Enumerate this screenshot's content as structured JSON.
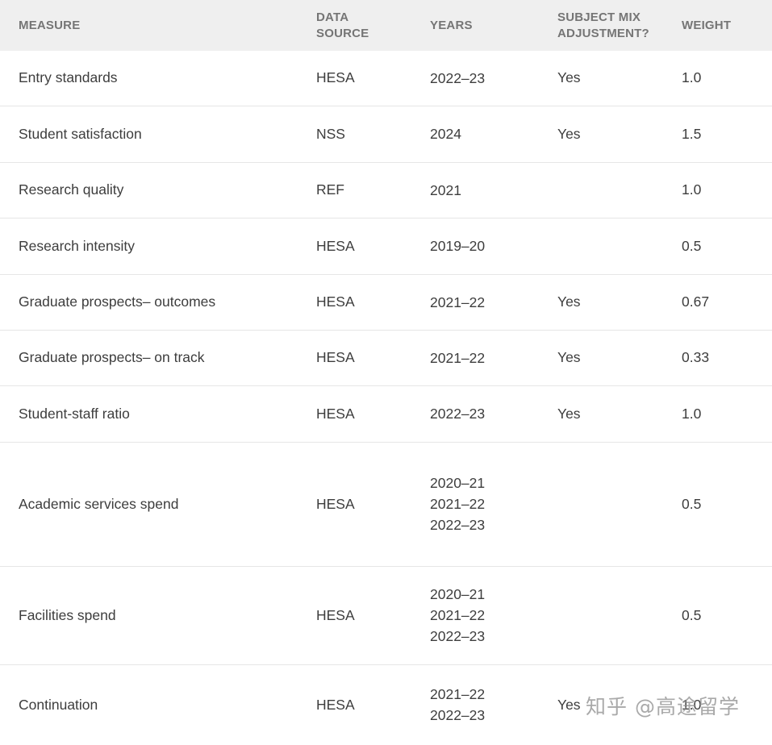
{
  "table": {
    "headers": {
      "measure": "MEASURE",
      "source_line1": "DATA",
      "source_line2": "SOURCE",
      "years": "YEARS",
      "adjust_line1": "SUBJECT MIX",
      "adjust_line2": "ADJUSTMENT?",
      "weight": "WEIGHT"
    },
    "rows": [
      {
        "measure": "Entry standards",
        "source": "HESA",
        "years": [
          "2022–23"
        ],
        "adjust": "Yes",
        "weight": "1.0"
      },
      {
        "measure": "Student satisfaction",
        "source": "NSS",
        "years": [
          "2024"
        ],
        "adjust": "Yes",
        "weight": "1.5"
      },
      {
        "measure": "Research quality",
        "source": "REF",
        "years": [
          "2021"
        ],
        "adjust": "",
        "weight": "1.0"
      },
      {
        "measure": "Research intensity",
        "source": "HESA",
        "years": [
          "2019–20"
        ],
        "adjust": "",
        "weight": "0.5"
      },
      {
        "measure": "Graduate prospects– outcomes",
        "source": "HESA",
        "years": [
          "2021–22"
        ],
        "adjust": "Yes",
        "weight": "0.67"
      },
      {
        "measure": "Graduate prospects– on track",
        "source": "HESA",
        "years": [
          "2021–22"
        ],
        "adjust": "Yes",
        "weight": "0.33"
      },
      {
        "measure": "Student-staff ratio",
        "source": "HESA",
        "years": [
          "2022–23"
        ],
        "adjust": "Yes",
        "weight": "1.0"
      },
      {
        "measure": "Academic services spend",
        "source": "HESA",
        "years": [
          "2020–21",
          "2021–22",
          "2022–23"
        ],
        "adjust": "",
        "weight": "0.5"
      },
      {
        "measure": "Facilities spend",
        "source": "HESA",
        "years": [
          "2020–21",
          "2021–22",
          "2022–23"
        ],
        "adjust": "",
        "weight": "0.5"
      },
      {
        "measure": "Continuation",
        "source": "HESA",
        "years": [
          "2021–22",
          "2022–23"
        ],
        "adjust": "Yes",
        "weight": "1.0"
      }
    ]
  },
  "watermark": "知乎 @高途留学"
}
